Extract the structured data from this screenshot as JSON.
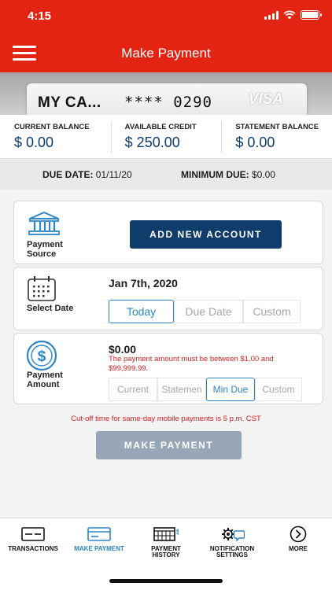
{
  "status_bar": {
    "time": "4:15"
  },
  "header": {
    "title": "Make Payment"
  },
  "card": {
    "name": "MY CA...",
    "number": "**** 0290",
    "brand": "VISA"
  },
  "balances": [
    {
      "label": "CURRENT BALANCE",
      "value": "$ 0.00"
    },
    {
      "label": "AVAILABLE CREDIT",
      "value": "$ 250.00"
    },
    {
      "label": "STATEMENT BALANCE",
      "value": "$ 0.00"
    }
  ],
  "due": {
    "date_label": "DUE DATE:",
    "date_value": "01/11/20",
    "min_label": "MINIMUM DUE:",
    "min_value": "$0.00"
  },
  "payment_source": {
    "label_line1": "Payment",
    "label_line2": "Source",
    "button": "ADD NEW ACCOUNT"
  },
  "select_date": {
    "label": "Select Date",
    "date": "Jan 7th, 2020",
    "options": [
      "Today",
      "Due Date",
      "Custom"
    ],
    "selected": "Today"
  },
  "payment_amount": {
    "label_line1": "Payment",
    "label_line2": "Amount",
    "amount": "$0.00",
    "error": "The payment amount must be between $1.00 and $99,999.99.",
    "options": [
      "Current",
      "Statemen",
      "Min Due",
      "Custom"
    ],
    "selected": "Min Due"
  },
  "cutoff_notice": "Cut-off time for same-day mobile payments is 5 p.m. CST",
  "make_payment_button": "MAKE PAYMENT",
  "bottom_nav": [
    {
      "label_1": "TRANSACTIONS",
      "label_2": "",
      "icon": "card-icon",
      "active": false
    },
    {
      "label_1": "MAKE PAYMENT",
      "label_2": "",
      "icon": "card-pay-icon",
      "active": true
    },
    {
      "label_1": "PAYMENT",
      "label_2": "HISTORY",
      "icon": "history-icon",
      "active": false
    },
    {
      "label_1": "NOTIFICATION",
      "label_2": "SETTINGS",
      "icon": "notification-settings-icon",
      "active": false
    },
    {
      "label_1": "MORE",
      "label_2": "",
      "icon": "chevron-right-icon",
      "active": false
    }
  ],
  "colors": {
    "brand_red": "#e32413",
    "navy": "#0f3c6b",
    "accent_blue": "#2a86c4",
    "error_red": "#d42020"
  }
}
